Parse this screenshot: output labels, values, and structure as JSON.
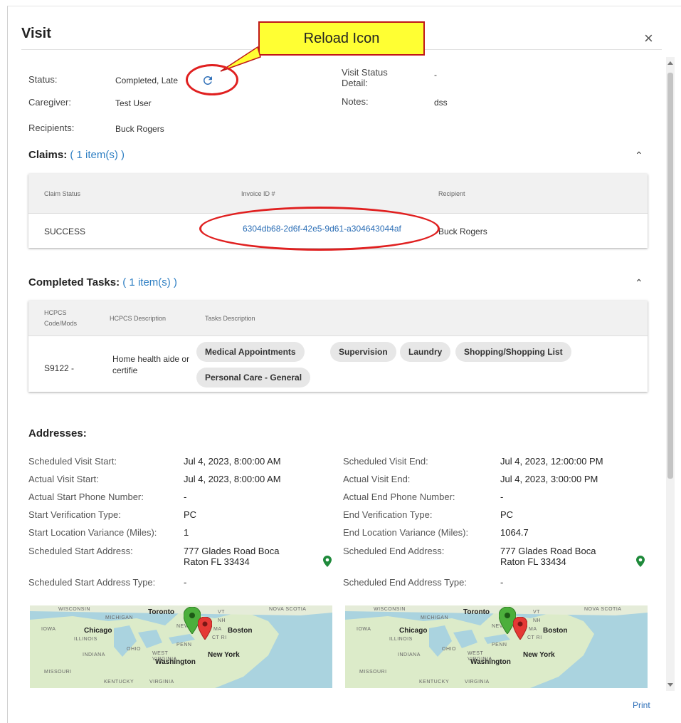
{
  "dialog": {
    "title": "Visit",
    "close_label": "×",
    "print_label": "Print"
  },
  "annotation": {
    "callout_text": "Reload Icon"
  },
  "summary": {
    "status_label": "Status:",
    "status_value": "Completed, Late",
    "caregiver_label": "Caregiver:",
    "caregiver_value": "Test User",
    "recipients_label": "Recipients:",
    "recipients_value": "Buck Rogers",
    "visit_status_detail_label_1": "Visit Status",
    "visit_status_detail_label_2": "Detail:",
    "visit_status_detail_value": "-",
    "notes_label": "Notes:",
    "notes_value": "dss",
    "reload_icon": "reload-icon"
  },
  "claims": {
    "title": "Claims:",
    "count": "( 1 item(s) )",
    "collapse_icon": "chevron-up-icon",
    "headers": [
      "Claim Status",
      "Invoice ID #",
      "Recipient"
    ],
    "rows": [
      {
        "status": "SUCCESS",
        "invoice_id": "6304db68-2d6f-42e5-9d61-a304643044af",
        "recipient": "Buck Rogers"
      }
    ]
  },
  "tasks": {
    "title": "Completed Tasks:",
    "count": "( 1 item(s) )",
    "collapse_icon": "chevron-up-icon",
    "headers": {
      "code_1": "HCPCS",
      "code_2": "Code/Mods",
      "description": "HCPCS Description",
      "tasks": "Tasks Description"
    },
    "rows": [
      {
        "code": "S9122 -",
        "description_1": "Home health aide or",
        "description_2": "certifie",
        "tasks": [
          "Medical Appointments",
          "Supervision",
          "Laundry",
          "Shopping/Shopping List",
          "Personal Care - General"
        ]
      }
    ]
  },
  "addresses": {
    "title": "Addresses:",
    "left": {
      "scheduled_start_label": "Scheduled Visit Start:",
      "scheduled_start_value": "Jul 4, 2023, 8:00:00 AM",
      "actual_start_label": "Actual Visit Start:",
      "actual_start_value": "Jul 4, 2023, 8:00:00 AM",
      "phone_label": "Actual Start Phone Number:",
      "phone_value": "-",
      "verification_label": "Start Verification Type:",
      "verification_value": "PC",
      "variance_label": "Start Location Variance (Miles):",
      "variance_value": "1",
      "address_label": "Scheduled Start Address:",
      "address_line_1": "777 Glades Road Boca",
      "address_line_2": "Raton FL 33434",
      "address_type_label": "Scheduled Start Address Type:",
      "address_type_value": "-",
      "pin_icon": "map-pin-icon"
    },
    "right": {
      "scheduled_end_label": "Scheduled Visit End:",
      "scheduled_end_value": "Jul 4, 2023, 12:00:00 PM",
      "actual_end_label": "Actual Visit End:",
      "actual_end_value": "Jul 4, 2023, 3:00:00 PM",
      "phone_label": "Actual End Phone Number:",
      "phone_value": "-",
      "verification_label": "End Verification Type:",
      "verification_value": "PC",
      "variance_label": "End Location Variance (Miles):",
      "variance_value": "1064.7",
      "address_label": "Scheduled End Address:",
      "address_line_1": "777 Glades Road Boca",
      "address_line_2": "Raton FL 33434",
      "address_type_label": "Scheduled End Address Type:",
      "address_type_value": "-",
      "pin_icon": "map-pin-icon"
    },
    "map_labels": {
      "wisconsin": "WISCONSIN",
      "michigan": "MICHIGAN",
      "toronto": "Toronto",
      "vt": "VT",
      "nova_scotia": "NOVA SCOTIA",
      "iowa": "IOWA",
      "chicago": "Chicago",
      "nh": "NH",
      "ma": "MA",
      "boston": "Boston",
      "ct_ri": "CT RI",
      "illinois": "ILLINOIS",
      "ohio": "OHIO",
      "penn": "PENN",
      "indiana": "INDIANA",
      "new_york": "New York",
      "washington": "Washington",
      "west_virginia": "WEST VIRGINIA",
      "missouri": "MISSOURI",
      "kentucky": "KENTUCKY",
      "virginia": "VIRGINIA",
      "nev": "NEV"
    }
  }
}
